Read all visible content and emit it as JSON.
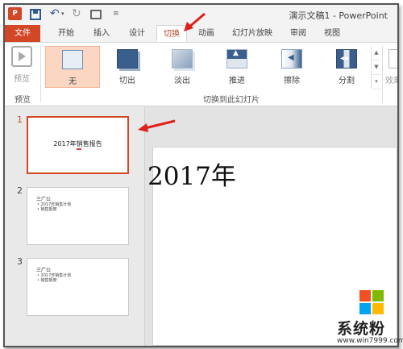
{
  "app": {
    "icon_letter": "P",
    "window_title": "演示文稿1 - PowerPoint"
  },
  "tabs": [
    {
      "id": "file",
      "label": "文件"
    },
    {
      "id": "home",
      "label": "开始"
    },
    {
      "id": "insert",
      "label": "插入"
    },
    {
      "id": "design",
      "label": "设计"
    },
    {
      "id": "transitions",
      "label": "切换"
    },
    {
      "id": "animations",
      "label": "动画"
    },
    {
      "id": "slideshow",
      "label": "幻灯片放映"
    },
    {
      "id": "review",
      "label": "审阅"
    },
    {
      "id": "view",
      "label": "视图"
    }
  ],
  "active_tab": "transitions",
  "ribbon": {
    "preview": {
      "label": "预览",
      "group_label": "预览"
    },
    "transitions_group_label": "切换到此幻灯片",
    "gallery": [
      {
        "label": "无",
        "icon": "none-transition-icon",
        "selected": true
      },
      {
        "label": "切出",
        "icon": "cut-transition-icon",
        "selected": false
      },
      {
        "label": "淡出",
        "icon": "fade-transition-icon",
        "selected": false
      },
      {
        "label": "推进",
        "icon": "push-transition-icon",
        "selected": false
      },
      {
        "label": "擦除",
        "icon": "wipe-transition-icon",
        "selected": false
      },
      {
        "label": "分割",
        "icon": "split-transition-icon",
        "selected": false
      }
    ],
    "effects_label": "效果"
  },
  "slides": [
    {
      "number": "1",
      "title": "2017年销售报告",
      "selected": true
    },
    {
      "number": "2",
      "heading": "三广公",
      "bullets": [
        "• 2017年销售计划",
        "• 销售额度"
      ]
    },
    {
      "number": "3",
      "heading": "三广公",
      "bullets": [
        "• 2017年销售计划",
        "• 销售额度"
      ]
    }
  ],
  "canvas": {
    "visible_text": "2017年"
  },
  "watermark": {
    "text": "系统粉",
    "url": "www.win7999.com"
  },
  "colors": {
    "accent": "#d24726",
    "arrow": "#e0201a"
  }
}
